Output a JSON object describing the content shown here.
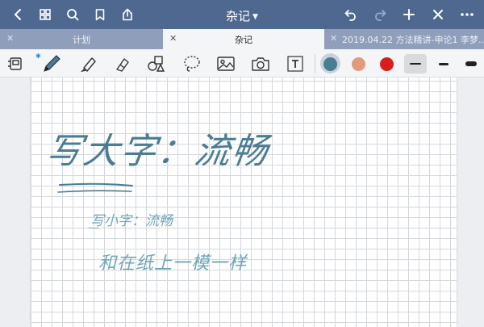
{
  "header": {
    "title": "杂记",
    "icons": [
      "back-icon",
      "grid-icon",
      "search-icon",
      "bookmark-icon",
      "share-icon",
      "undo-icon",
      "redo-icon",
      "add-icon",
      "close-icon",
      "more-icon"
    ]
  },
  "tabs": [
    {
      "label": "计划",
      "active": false
    },
    {
      "label": "杂记",
      "active": true
    },
    {
      "label": "2019.04.22 方法精讲-申论1 李梦…",
      "active": false
    }
  ],
  "toolbar": {
    "bluetooth_symbol": "✱",
    "text_tool_label": "T",
    "colors": [
      "#4a7c92",
      "#e09a7f",
      "#d81d1d"
    ],
    "selected_color": "#4a7c92",
    "selected_thickness": 0
  },
  "note": {
    "heading_ink": "写大字：流畅",
    "line1_ink": "写小字：流畅",
    "line2_ink": "和在纸上一模一样",
    "ink_color": "#4a7c92"
  }
}
